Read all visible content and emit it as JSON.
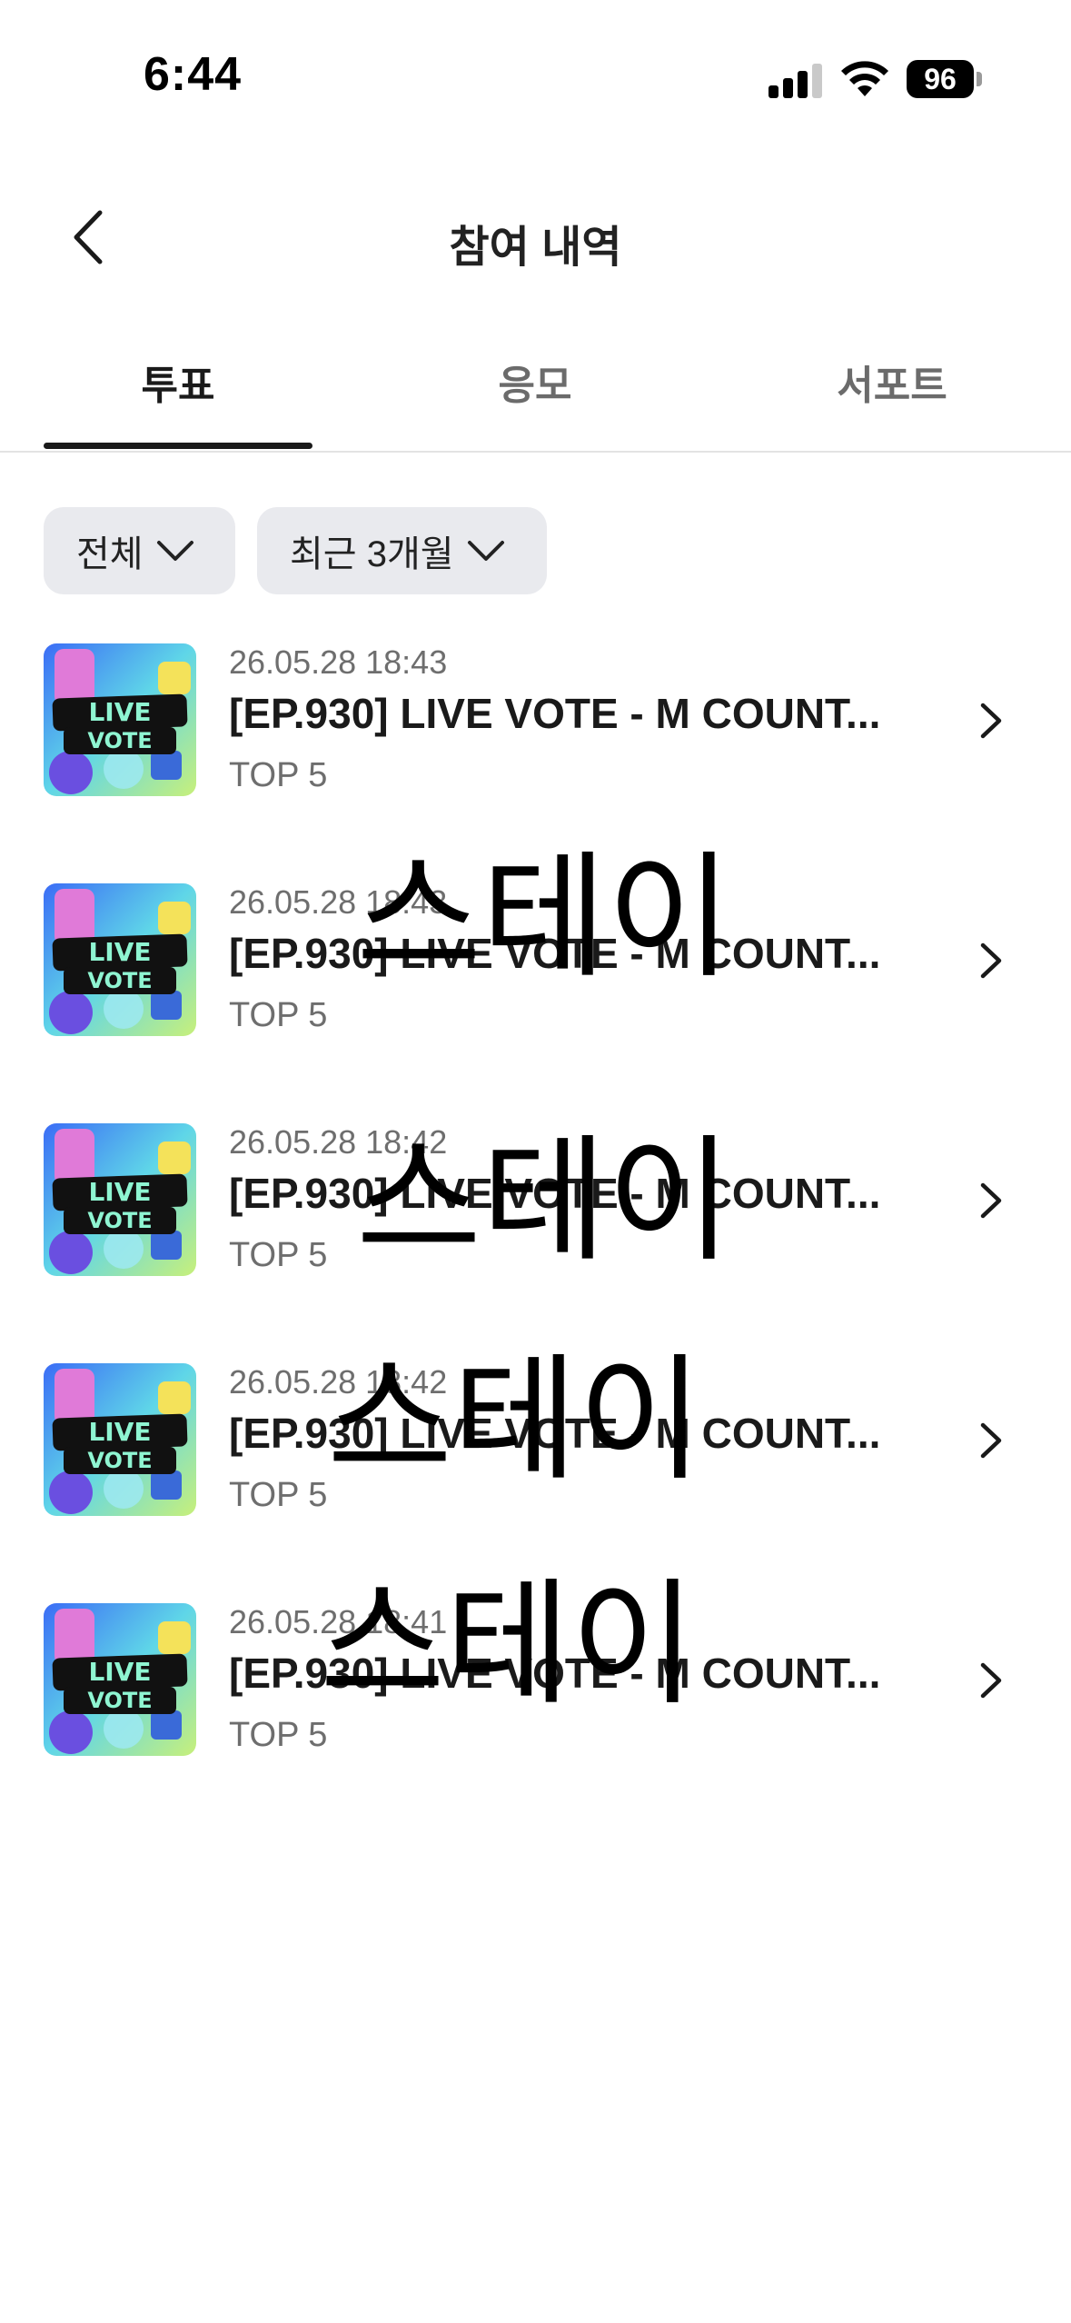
{
  "status_bar": {
    "time": "6:44",
    "battery": "96"
  },
  "header": {
    "title": "참여 내역"
  },
  "tabs": [
    {
      "label": "투표",
      "active": true
    },
    {
      "label": "응모",
      "active": false
    },
    {
      "label": "서포트",
      "active": false
    }
  ],
  "filters": [
    {
      "label": "전체"
    },
    {
      "label": "최근 3개월"
    }
  ],
  "thumbnail": {
    "line1": "LIVE",
    "line2": "VOTE"
  },
  "items": [
    {
      "date": "26.05.28 18:43",
      "title": "[EP.930] LIVE VOTE - M COUNT...",
      "subtitle": "TOP 5"
    },
    {
      "date": "26.05.28 18:43",
      "title": "[EP.930] LIVE VOTE - M COUNT...",
      "subtitle": "TOP 5"
    },
    {
      "date": "26.05.28 18:42",
      "title": "[EP.930] LIVE VOTE - M COUNT...",
      "subtitle": "TOP 5"
    },
    {
      "date": "26.05.28 18:42",
      "title": "[EP.930] LIVE VOTE - M COUNT...",
      "subtitle": "TOP 5"
    },
    {
      "date": "26.05.28 18:41",
      "title": "[EP.930] LIVE VOTE - M COUNT...",
      "subtitle": "TOP 5"
    }
  ],
  "overlay_text": [
    "스테이",
    "스테이",
    "스테이",
    "스테이"
  ]
}
